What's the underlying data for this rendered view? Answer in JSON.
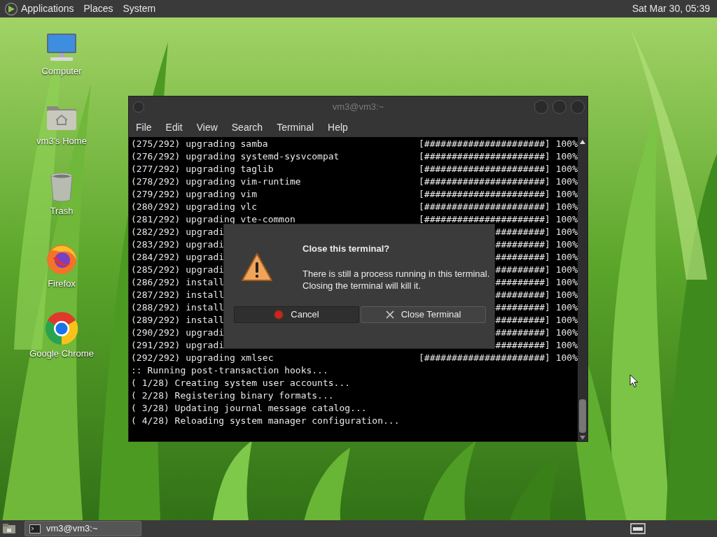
{
  "top_panel": {
    "menus": [
      "Applications",
      "Places",
      "System"
    ],
    "clock": "Sat Mar 30, 05:39"
  },
  "desktop_icons": [
    {
      "kind": "computer",
      "label": "Computer"
    },
    {
      "kind": "home",
      "label": "vm3's Home"
    },
    {
      "kind": "trash",
      "label": "Trash"
    },
    {
      "kind": "firefox",
      "label": "Firefox"
    },
    {
      "kind": "chrome",
      "label": "Google Chrome"
    }
  ],
  "terminal": {
    "title": "vm3@vm3:~",
    "menu": [
      "File",
      "Edit",
      "View",
      "Search",
      "Terminal",
      "Help"
    ],
    "lines": [
      {
        "text": "(275/292) upgrading samba",
        "progress": "[######################] 100%"
      },
      {
        "text": "(276/292) upgrading systemd-sysvcompat",
        "progress": "[######################] 100%"
      },
      {
        "text": "(277/292) upgrading taglib",
        "progress": "[######################] 100%"
      },
      {
        "text": "(278/292) upgrading vim-runtime",
        "progress": "[######################] 100%"
      },
      {
        "text": "(279/292) upgrading vim",
        "progress": "[######################] 100%"
      },
      {
        "text": "(280/292) upgrading vlc",
        "progress": "[######################] 100%"
      },
      {
        "text": "(281/292) upgrading vte-common",
        "progress": "[######################] 100%"
      },
      {
        "text": "(282/292) upgradi",
        "progress": "#########] 100%"
      },
      {
        "text": "(283/292) upgradi",
        "progress": "#########] 100%"
      },
      {
        "text": "(284/292) upgradi",
        "progress": "#########] 100%"
      },
      {
        "text": "(285/292) upgradi",
        "progress": "#########] 100%"
      },
      {
        "text": "(286/292) install",
        "progress": "#########] 100%"
      },
      {
        "text": "(287/292) install",
        "progress": "#########] 100%"
      },
      {
        "text": "(288/292) install",
        "progress": "#########] 100%"
      },
      {
        "text": "(289/292) install",
        "progress": "#########] 100%"
      },
      {
        "text": "(290/292) upgradi",
        "progress": "#########] 100%"
      },
      {
        "text": "(291/292) upgradi",
        "progress": "#########] 100%"
      },
      {
        "text": "(292/292) upgrading xmlsec",
        "progress": "[######################] 100%"
      },
      {
        "text": ":: Running post-transaction hooks..."
      },
      {
        "text": "( 1/28) Creating system user accounts..."
      },
      {
        "text": "( 2/28) Registering binary formats..."
      },
      {
        "text": "( 3/28) Updating journal message catalog..."
      },
      {
        "text": "( 4/28) Reloading system manager configuration..."
      }
    ]
  },
  "dialog": {
    "title": "Close this terminal?",
    "message": "There is still a process running in this terminal.\nClosing the terminal will kill it.",
    "buttons": [
      {
        "kind": "cancel",
        "label": "Cancel"
      },
      {
        "kind": "close",
        "label": "Close Terminal"
      }
    ]
  },
  "taskbar": {
    "windows": [
      {
        "label": "vm3@vm3:~"
      }
    ]
  }
}
